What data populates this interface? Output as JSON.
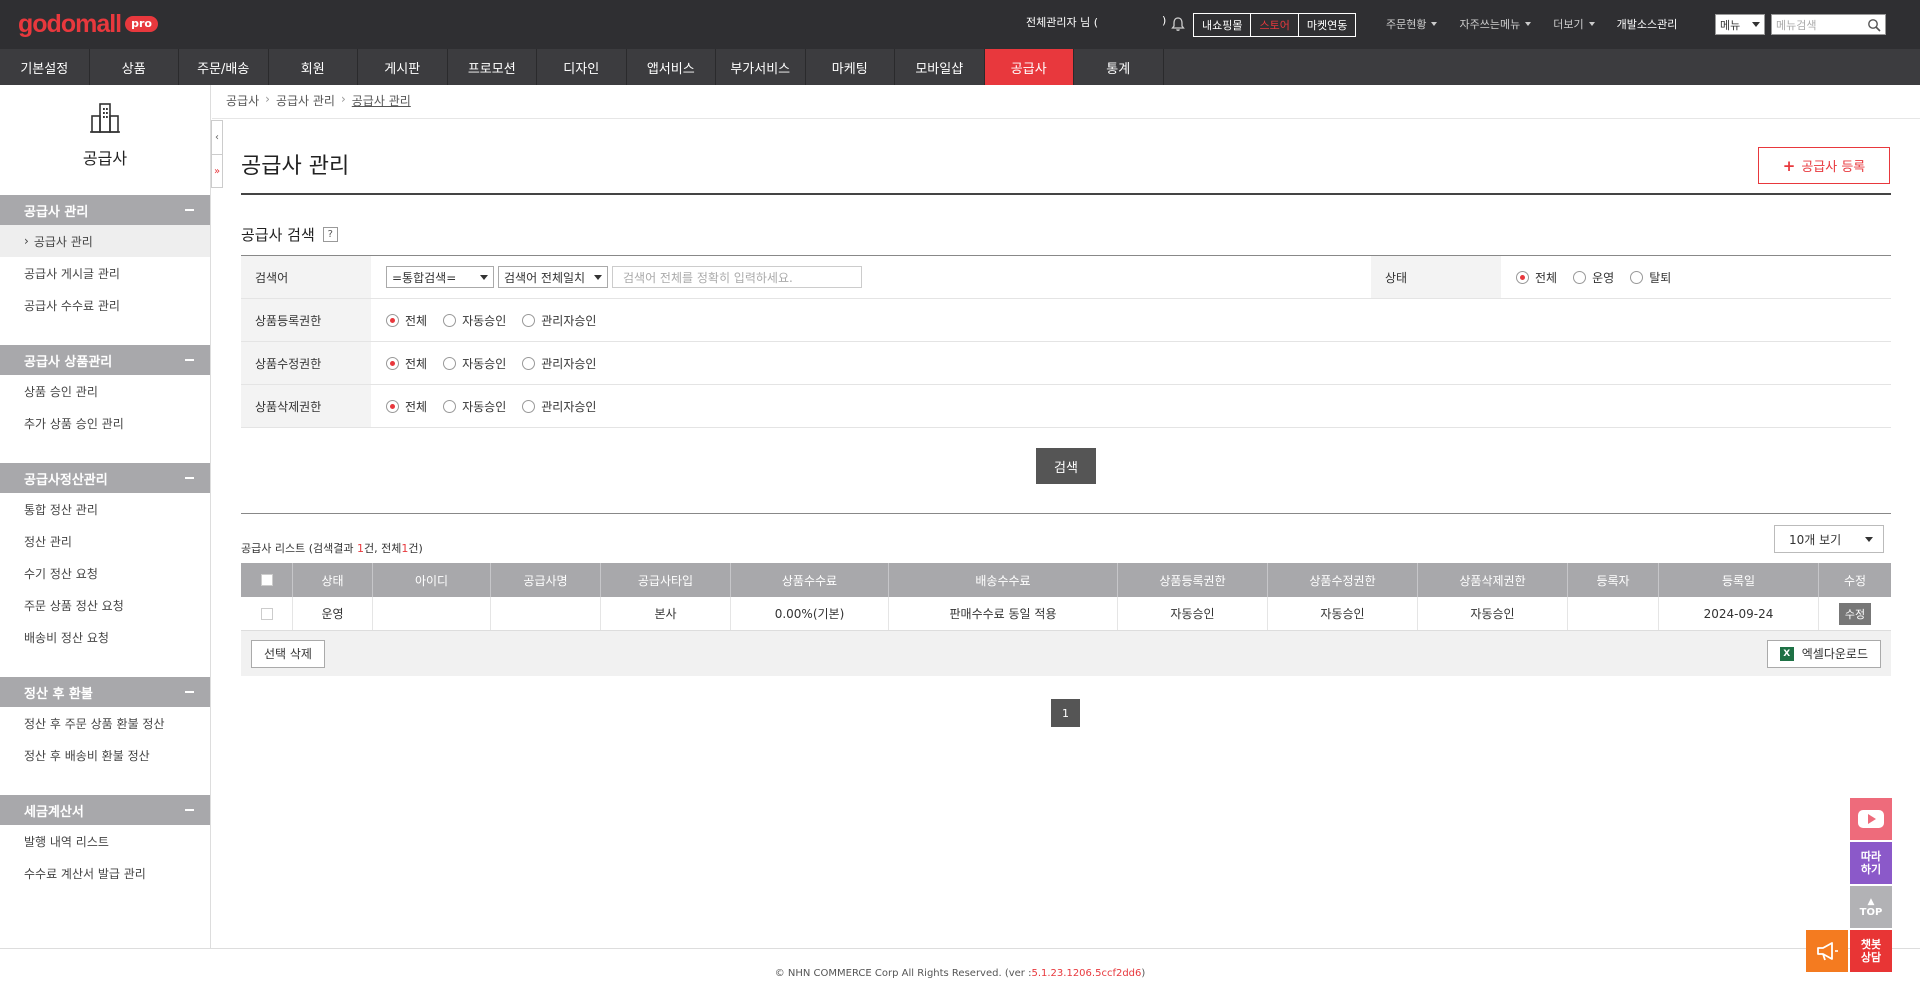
{
  "logo": {
    "text": "godomall",
    "badge": "pro"
  },
  "topbar": {
    "admin_name": "전체관리자 님 (",
    "admin_paren_close": ")",
    "buttons": [
      "내쇼핑몰",
      "스토어",
      "마켓연동"
    ],
    "links": [
      "주문현황",
      "자주쓰는메뉴",
      "더보기",
      "개발소스관리"
    ],
    "menu_select": "메뉴",
    "menu_search_placeholder": "메뉴검색"
  },
  "nav": [
    "기본설정",
    "상품",
    "주문/배송",
    "회원",
    "게시판",
    "프로모션",
    "디자인",
    "앱서비스",
    "부가서비스",
    "마케팅",
    "모바일샵",
    "공급사",
    "통계"
  ],
  "sidebar": {
    "title": "공급사",
    "groups": [
      {
        "title": "공급사 관리",
        "items": [
          "공급사 관리",
          "공급사 게시글 관리",
          "공급사 수수료 관리"
        ]
      },
      {
        "title": "공급사 상품관리",
        "items": [
          "상품 승인 관리",
          "추가 상품 승인 관리"
        ]
      },
      {
        "title": "공급사정산관리",
        "items": [
          "통합 정산 관리",
          "정산 관리",
          "수기 정산 요청",
          "주문 상품 정산 요청",
          "배송비 정산 요청"
        ]
      },
      {
        "title": "정산 후 환불",
        "items": [
          "정산 후 주문 상품 환불 정산",
          "정산 후 배송비 환불 정산"
        ]
      },
      {
        "title": "세금계산서",
        "items": [
          "발행 내역 리스트",
          "수수료 계산서 발급 관리"
        ]
      }
    ],
    "collapse_icon": "‹",
    "scroll_icon": "»"
  },
  "breadcrumb": [
    "공급사",
    "공급사 관리",
    "공급사 관리"
  ],
  "page": {
    "title": "공급사 관리",
    "register_button": "공급사 등록"
  },
  "search": {
    "title": "공급사 검색",
    "help": "?",
    "keyword_label": "검색어",
    "keyword_select1": "=통합검색=",
    "keyword_select2": "검색어 전체일치",
    "keyword_placeholder": "검색어 전체를 정확히 입력하세요.",
    "status_label": "상태",
    "status_options": [
      "전체",
      "운영",
      "탈퇴"
    ],
    "reg_perm_label": "상품등록권한",
    "edit_perm_label": "상품수정권한",
    "del_perm_label": "상품삭제권한",
    "perm_options": [
      "전체",
      "자동승인",
      "관리자승인"
    ],
    "search_button": "검색"
  },
  "list": {
    "caption_prefix": "공급사 리스트 (검색결과 ",
    "result_count": "1",
    "caption_mid": "건, 전체",
    "total_count": "1",
    "caption_suffix": "건)",
    "page_size": "10개 보기",
    "columns": [
      "상태",
      "아이디",
      "공급사명",
      "공급사타입",
      "상품수수료",
      "배송수수료",
      "상품등록권한",
      "상품수정권한",
      "상품삭제권한",
      "등록자",
      "등록일",
      "수정"
    ],
    "rows": [
      [
        "운영",
        "",
        "",
        "본사",
        "0.00%(기본)",
        "판매수수료 동일 적용",
        "자동승인",
        "자동승인",
        "자동승인",
        "",
        "2024-09-24",
        "수정"
      ]
    ],
    "delete_button": "선택 삭제",
    "excel_button": "엑셀다운로드",
    "page": "1"
  },
  "footer": {
    "copyright": "© NHN COMMERCE Corp All Rights Reserved.  (ver : ",
    "version": "5.1.23.1206.5ccf2dd6",
    "close": ")"
  },
  "floating": {
    "follow": "따라\n하기",
    "top": "TOP",
    "chat": "챗봇\n상담"
  },
  "colors": {
    "accent": "#e8383d",
    "topbar": "#2f2f32",
    "nav": "#3c3c3f",
    "header_gray": "#a8a8ab"
  }
}
